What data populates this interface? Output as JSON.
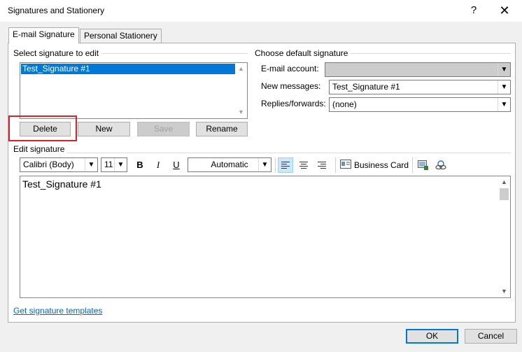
{
  "window": {
    "title": "Signatures and Stationery",
    "help_glyph": "?",
    "close_glyph": "✕"
  },
  "tabs": [
    {
      "label": "E-mail Signature",
      "active": true
    },
    {
      "label": "Personal Stationery",
      "active": false
    }
  ],
  "select_group": {
    "label": "Select signature to edit",
    "items": [
      "Test_Signature #1"
    ]
  },
  "signature_buttons": {
    "delete": "Delete",
    "new": "New",
    "save": "Save",
    "rename": "Rename"
  },
  "default_group": {
    "label": "Choose default signature",
    "email_account_label": "E-mail account:",
    "email_account_value": "",
    "new_messages_label": "New messages:",
    "new_messages_value": "Test_Signature #1",
    "replies_label": "Replies/forwards:",
    "replies_value": "(none)"
  },
  "edit_group": {
    "label": "Edit signature",
    "font": "Calibri (Body)",
    "size": "11",
    "bold": "B",
    "italic": "I",
    "underline": "U",
    "color": "Automatic",
    "business_card": "Business Card"
  },
  "editor": {
    "content": "Test_Signature #1"
  },
  "footer": {
    "templates_link": "Get signature templates",
    "ok": "OK",
    "cancel": "Cancel"
  },
  "colors": {
    "accent": "#0078d7",
    "highlight": "#d9232a",
    "link": "#0066cc"
  },
  "icons": [
    "help-icon",
    "close-icon",
    "chevron-down-icon",
    "align-left-icon",
    "align-center-icon",
    "align-right-icon",
    "business-card-icon",
    "insert-picture-icon",
    "hyperlink-icon"
  ]
}
